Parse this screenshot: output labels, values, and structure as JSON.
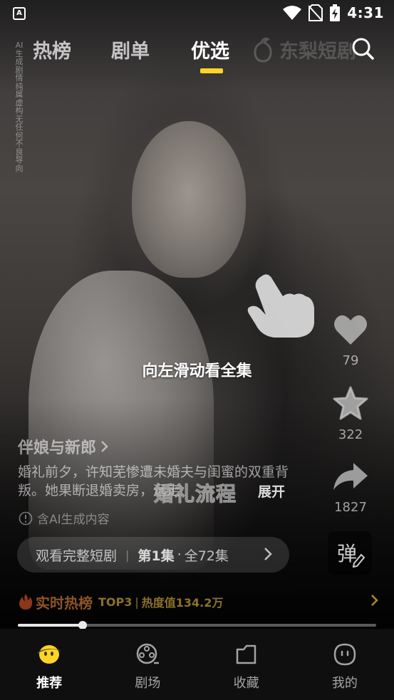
{
  "status_bar": {
    "time": "4:31",
    "app_icon_letter": "A"
  },
  "top_nav": {
    "tabs": [
      {
        "label": "热榜"
      },
      {
        "label": "剧单"
      },
      {
        "label": "优选"
      }
    ],
    "active_index": 2,
    "watermark_brand": "东梨短剧",
    "accent_color": "#ffd426"
  },
  "disclaimer_vertical": "AI生成剧情纯属虚构无任何不良导向",
  "swipe_hint": "向左滑动看全集",
  "actions": {
    "like_count": "79",
    "favorite_count": "322",
    "share_count": "1827",
    "danmu_label": "弹"
  },
  "drama": {
    "title": "伴娘与新郎",
    "description": "婚礼前夕，许知芜惨遭未婚夫与闺蜜的双重背叛。她果断退婚卖房，远走",
    "expand_label": "展开",
    "subtitle_caption": "婚礼流程",
    "ai_note": "含AI生成内容"
  },
  "watch_full": {
    "label": "观看完整短剧",
    "separator": "|",
    "episode": "第1集",
    "dot": "·",
    "total": "全72集"
  },
  "hot_rank": {
    "label": "实时热榜",
    "rank": "TOP3",
    "separator": "|",
    "heat": "热度值134.2万"
  },
  "progress": {
    "fraction": 0.18
  },
  "bottom_nav": {
    "items": [
      {
        "label": "推荐",
        "icon": "recommend-face-icon"
      },
      {
        "label": "剧场",
        "icon": "film-reel-icon"
      },
      {
        "label": "收藏",
        "icon": "folder-icon"
      },
      {
        "label": "我的",
        "icon": "profile-face-icon"
      }
    ],
    "active_index": 0
  }
}
